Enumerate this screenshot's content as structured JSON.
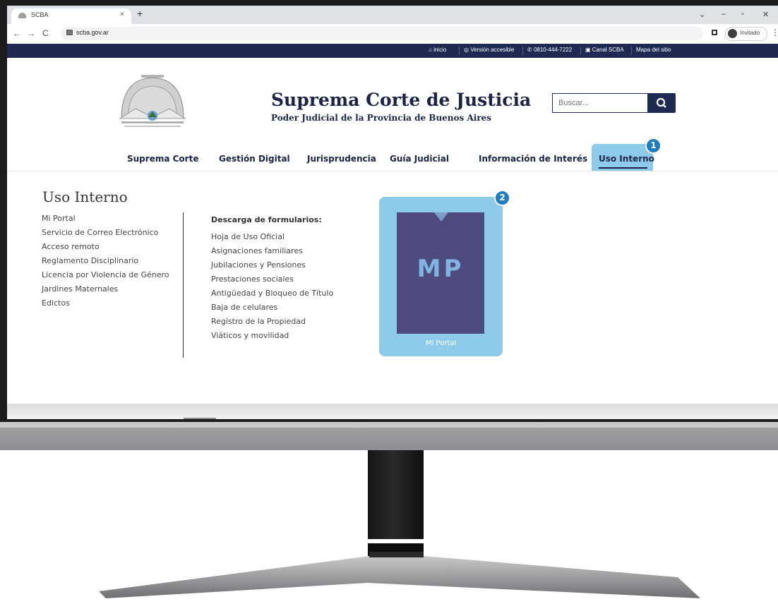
{
  "browser": {
    "tab_title": "SCBA",
    "tab_close": "×",
    "new_tab": "+",
    "url": "scba.gov.ar",
    "profile_label": "Invitado",
    "window_controls": {
      "minimize": "–",
      "maximize": "▫",
      "close": "✕",
      "tablist": "⌄"
    }
  },
  "topbar": {
    "inicio": "inicio",
    "accessible": "Versión accesible",
    "phone": "0810-444-7222",
    "canal": "Canal SCBA",
    "mapa": "Mapa del sitio"
  },
  "header": {
    "title": "Suprema Corte de Justicia",
    "subtitle": "Poder Judicial de la Provincia de Buenos Aires",
    "search_placeholder": "Buscar..."
  },
  "nav": {
    "items": [
      "Suprema Corte",
      "Gestión Digital",
      "Jurisprudencia",
      "Guía Judicial",
      "Información de Interés",
      "Uso Interno"
    ]
  },
  "dropdown": {
    "title": "Uso Interno",
    "left_links": [
      "Mi Portal",
      "Servicio de Correo Electrónico",
      "Acceso remoto",
      "Reglamento Disciplinario",
      "Licencia por Violencia de Género",
      "Jardines Maternales",
      "Edictos"
    ],
    "forms_heading": "Descarga de formularios:",
    "form_links": [
      "Hoja de Uso Oficial",
      "Asignaciones familiares",
      "Jubilaciones y Pensiones",
      "Prestaciones sociales",
      "Antigüedad y Bloqueo de Título",
      "Baja de celulares",
      "Registro de la Propiedad",
      "Viáticos y movilidad"
    ],
    "card_text": "MP",
    "card_caption": "Mi Portal"
  },
  "badges": {
    "one": "1",
    "two": "2"
  },
  "colors": {
    "navy": "#1e2a52",
    "highlight": "#8ecbea",
    "badge": "#1f7cc1",
    "card": "#4e4b7e"
  }
}
